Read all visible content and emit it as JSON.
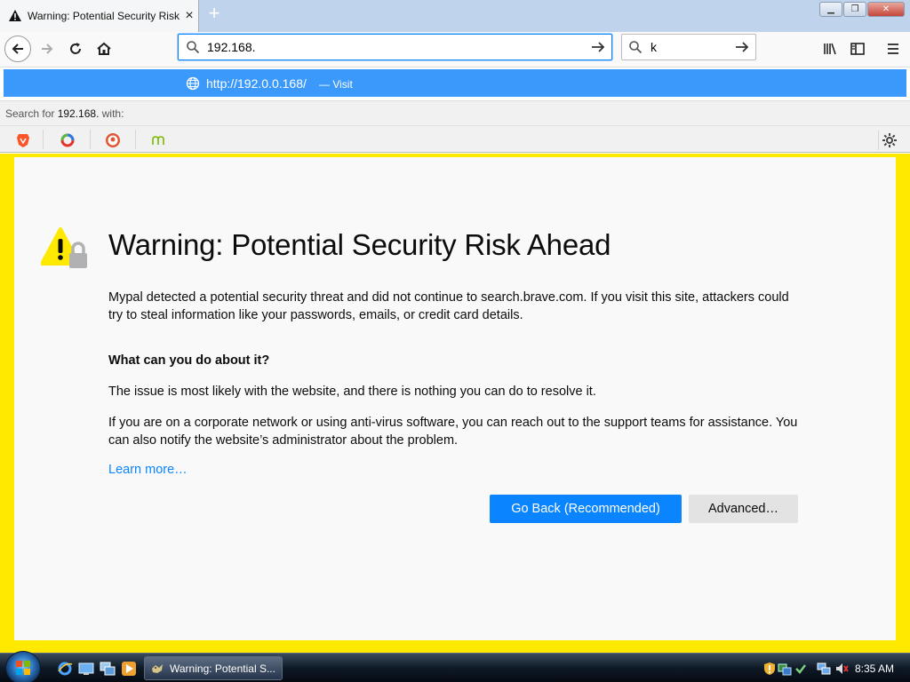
{
  "browser": {
    "tab": {
      "title": "Warning: Potential Security Risk Ahead",
      "close_icon": "×"
    },
    "new_tab_label": "+",
    "window_buttons": {
      "minimize": "▁",
      "maximize": "❐",
      "close": "✕"
    },
    "urlbar": {
      "value": "192.168."
    },
    "searchbar": {
      "value": "k"
    },
    "suggestion": {
      "url": "http://192.0.0.168/",
      "action": "— Visit"
    },
    "search_for": {
      "prefix": "Search for ",
      "term": "192.168.",
      "suffix": " with:"
    },
    "search_engines": [
      "brave-icon",
      "qwant-icon",
      "duckduckgo-icon",
      "mojeek-icon"
    ]
  },
  "page": {
    "title": "Warning: Potential Security Risk Ahead",
    "intro": "Mypal detected a potential security threat and did not continue to search.brave.com. If you visit this site, attackers could try to steal information like your passwords, emails, or credit card details.",
    "question": "What can you do about it?",
    "issue": "The issue is most likely with the website, and there is nothing you can do to resolve it.",
    "advice": "If you are on a corporate network or using anti-virus software, you can reach out to the support teams for assistance. You can also notify the website’s administrator about the problem.",
    "learn_more": "Learn more…",
    "go_back": "Go Back (Recommended)",
    "advanced": "Advanced…"
  },
  "colors": {
    "accent": "#0a84ff",
    "warning_yellow": "#ffe900",
    "suggestion_blue": "#3b99fc"
  },
  "taskbar": {
    "task_title": "Warning: Potential S...",
    "clock": "8:35 AM"
  }
}
